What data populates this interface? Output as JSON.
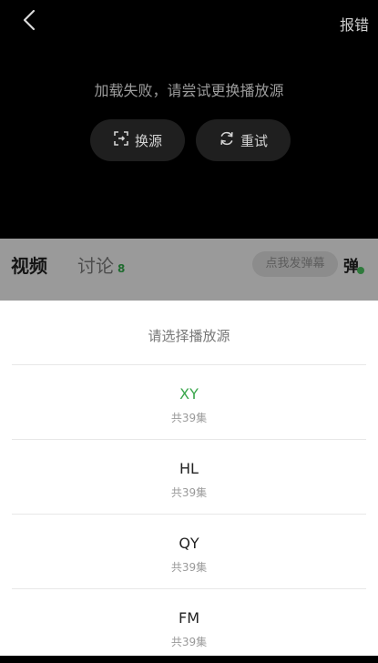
{
  "player": {
    "report_label": "报错",
    "error_message": "加载失败，请尝试更换播放源",
    "switch_label": "换源",
    "retry_label": "重试"
  },
  "tabs": {
    "video_label": "视频",
    "discuss_label": "讨论",
    "discuss_count": "8",
    "danmaku_placeholder": "点我发弹幕",
    "danmaku_toggle": "弹"
  },
  "sheet": {
    "title": "请选择播放源",
    "sources": [
      {
        "name": "XY",
        "count": "共39集",
        "active": true
      },
      {
        "name": "HL",
        "count": "共39集",
        "active": false
      },
      {
        "name": "QY",
        "count": "共39集",
        "active": false
      },
      {
        "name": "FM",
        "count": "共39集",
        "active": false
      }
    ]
  },
  "colors": {
    "accent": "#3aa64c",
    "player_bg": "#000000",
    "sheet_bg": "#ffffff"
  }
}
